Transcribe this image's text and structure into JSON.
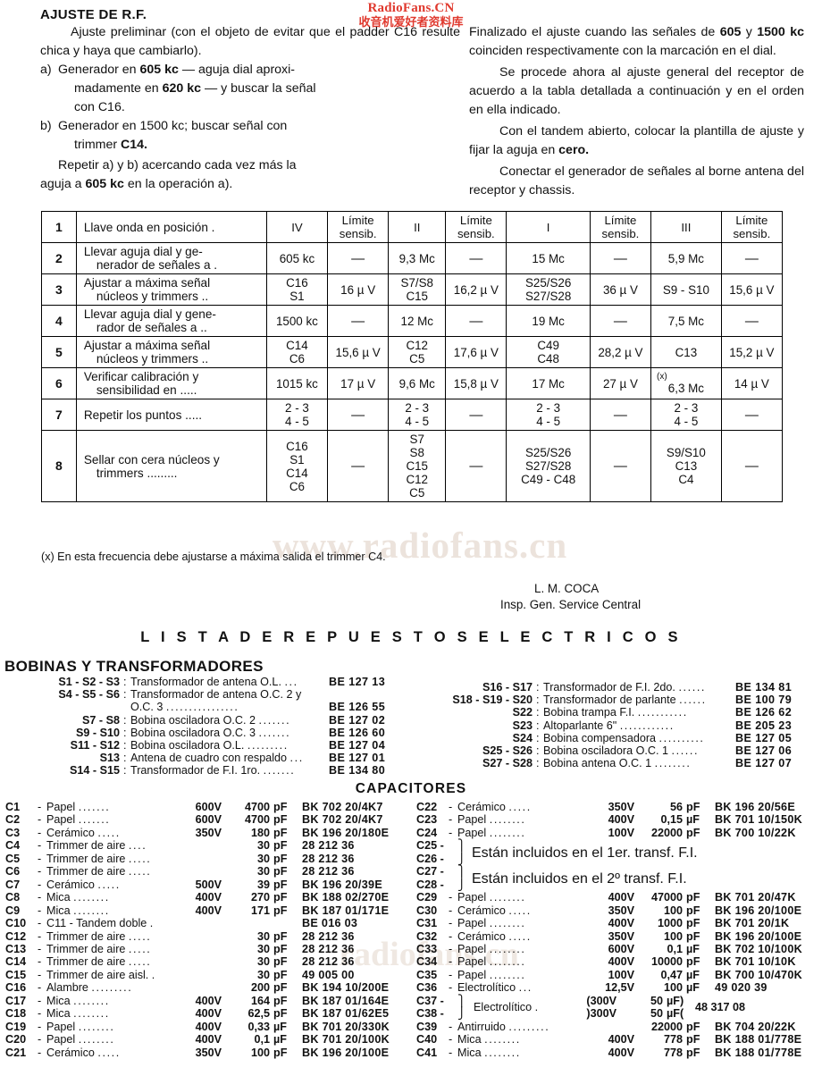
{
  "watermark": {
    "top_line1": "RadioFans.CN",
    "top_line2": "收音机爱好者资料库",
    "mid": "www.radiofans.cn",
    "mid2": "radiofans.cn"
  },
  "rf": {
    "title": "AJUSTE DE R.F.",
    "left": {
      "p1": "Ajuste preliminar (con el objeto de evitar que el padder C16 resulte chica y haya que cambiarlo).",
      "a_mark": "a)",
      "a_text": "Generador en 605 kc — aguja dial aproximadamente en 620 kc — y buscar la señal con C16.",
      "a_seg1": "Generador en ",
      "a_b1": "605 kc",
      "a_seg2": " — aguja dial aproxi-",
      "a_seg3": "madamente en ",
      "a_b2": "620 kc",
      "a_seg4": " — y buscar la señal",
      "a_seg5": "con C16.",
      "b_mark": "b)",
      "b_seg1": "Generador en 1500 kc; buscar señal con",
      "b_seg2": "trimmer ",
      "b_b1": "C14.",
      "p2_seg1": "Repetir a) y b) acercando cada vez más la",
      "p2_seg2": "aguja a ",
      "p2_b1": "605 kc",
      "p2_seg3": " en la operación a)."
    },
    "right": {
      "p1_seg1": "Finalizado el ajuste cuando las señales de",
      "p1_b1": "605",
      "p1_seg2": " y ",
      "p1_b2": "1500 kc",
      "p1_seg3": " coinciden respectivamente con la marcación en el dial.",
      "p2": "Se procede ahora al ajuste general del receptor de acuerdo a la tabla detallada a continuación y en el orden en ella indicado.",
      "p3_seg1": "Con el tandem abierto, colocar la plantilla de ajuste y fijar la aguja en ",
      "p3_b1": "cero.",
      "p4": "Conectar el generador de señales al borne antena del receptor y chassis."
    }
  },
  "table": {
    "header": {
      "num": "1",
      "desc": "Llave onda en posición .",
      "c_iv": "IV",
      "c_lim1": "Límite sensib.",
      "c_ii": "II",
      "c_lim2": "Límite sensib.",
      "c_i": "I",
      "c_lim3": "Límite sensib.",
      "c_iii": "III",
      "c_lim4": "Límite sensib."
    },
    "lim_l1": "Límite",
    "lim_l2": "sensib.",
    "rows": [
      {
        "num": "2",
        "desc_l1": "Llevar aguja dial y ge-",
        "desc_l2": "nerador de señales a .",
        "iv": "605 kc",
        "lim1": "—",
        "ii": "9,3 Mc",
        "lim2": "—",
        "i": "15 Mc",
        "lim3": "—",
        "iii": "5,9 Mc",
        "lim4": "—"
      },
      {
        "num": "3",
        "desc_l1": "Ajustar a máxima señal",
        "desc_l2": "núcleos y trimmers ..",
        "iv": "C16\nS1",
        "lim1": "16 µ V",
        "ii": "S7/S8\nC15",
        "lim2": "16,2 µ V",
        "i": "S25/S26\nS27/S28",
        "lim3": "36 µ V",
        "iii": "S9 - S10",
        "lim4": "15,6 µ V"
      },
      {
        "num": "4",
        "desc_l1": "Llevar aguja dial y gene-",
        "desc_l2": "rador de señales a ..",
        "iv": "1500 kc",
        "lim1": "—",
        "ii": "12 Mc",
        "lim2": "—",
        "i": "19 Mc",
        "lim3": "—",
        "iii": "7,5 Mc",
        "lim4": "—"
      },
      {
        "num": "5",
        "desc_l1": "Ajustar a máxima señal",
        "desc_l2": "núcleos y trimmers ..",
        "iv": "C14\nC6",
        "lim1": "15,6 µ V",
        "ii": "C12\nC5",
        "lim2": "17,6 µ V",
        "i": "C49\nC48",
        "lim3": "28,2 µ V",
        "iii": "C13",
        "lim4": "15,2 µ V"
      },
      {
        "num": "6",
        "desc_l1": "Verificar calibración y",
        "desc_l2": "sensibilidad en .....",
        "iv": "1015 kc",
        "lim1": "17 µ V",
        "ii": "9,6 Mc",
        "lim2": "15,8 µ V",
        "i": "17 Mc",
        "lim3": "27 µ V",
        "iii": "6,3 Mc",
        "iii_mark": "(x)",
        "lim4": "14 µ V"
      },
      {
        "num": "7",
        "desc_l1": "Repetir los puntos .....",
        "desc_l2": "",
        "iv": "2 - 3\n4 - 5",
        "lim1": "—",
        "ii": "2 - 3\n4 - 5",
        "lim2": "—",
        "i": "2 - 3\n4 - 5",
        "lim3": "—",
        "iii": "2 - 3\n4 - 5",
        "lim4": "—"
      },
      {
        "num": "8",
        "desc_l1": "Sellar con cera núcleos y",
        "desc_l2": "trimmers .........",
        "iv": "C16\nS1\nC14\nC6",
        "lim1": "—",
        "ii": "S7\nS8\nC15\nC12\nC5",
        "lim2": "—",
        "i": "S25/S26\nS27/S28\nC49 - C48",
        "lim3": "—",
        "iii": "S9/S10\nC13\nC4",
        "lim4": "—"
      }
    ]
  },
  "footnote": "(x)  En esta frecuencia debe ajustarse a máxima salida el trimmer C4.",
  "signature": {
    "name": "L. M. COCA",
    "role": "Insp. Gen. Service Central"
  },
  "sections": {
    "lista": "L I S T A   D E   R E P U E S T O S   E L E C T R I C O S",
    "bobinas": "BOBINAS Y TRANSFORMADORES",
    "capacitores": "CAPACITORES"
  },
  "coils_left": [
    {
      "ref": "S1 - S2 - S3",
      "colon": ":",
      "name": "Transformador de antena O.L.",
      "dots": "...",
      "pn": "BE 127 13"
    },
    {
      "ref": "S4 - S5 - S6",
      "colon": ":",
      "name": "Transformador de antena O.C. 2 y",
      "dots": "",
      "pn": ""
    },
    {
      "ref": "",
      "colon": "",
      "name": "O.C. 3",
      "dots": "................",
      "pn": "BE 126 55"
    },
    {
      "ref": "S7 - S8",
      "colon": ":",
      "name": "Bobina osciladora O.C. 2",
      "dots": ".......",
      "pn": "BE 127 02"
    },
    {
      "ref": "S9 - S10",
      "colon": ":",
      "name": "Bobina osciladora O.C. 3",
      "dots": ".......",
      "pn": "BE 126 60"
    },
    {
      "ref": "S11 - S12",
      "colon": ":",
      "name": "Bobina osciladora O.L.",
      "dots": ".........",
      "pn": "BE 127 04"
    },
    {
      "ref": "S13",
      "colon": ":",
      "name": "Antena de cuadro con respaldo",
      "dots": "...",
      "pn": "BE 127 01"
    },
    {
      "ref": "S14 - S15",
      "colon": ":",
      "name": "Transformador de F.I. 1ro.",
      "dots": ".......",
      "pn": "BE 134 80"
    }
  ],
  "coils_right": [
    {
      "ref": "S16 - S17",
      "colon": ":",
      "name": "Transformador de F.I. 2do.",
      "dots": "......",
      "pn": "BE 134 81"
    },
    {
      "ref": "S18 - S19 - S20",
      "colon": ":",
      "name": "Transformador de parlante",
      "dots": "......",
      "pn": "BE 100 79"
    },
    {
      "ref": "S22",
      "colon": ":",
      "name": "Bobina trampa F.I.",
      "dots": "...........",
      "pn": "BE 126 62"
    },
    {
      "ref": "S23",
      "colon": ":",
      "name": "Altoparlante 6\"",
      "dots": "............",
      "pn": "BE 205 23"
    },
    {
      "ref": "S24",
      "colon": ":",
      "name": "Bobina compensadora",
      "dots": "..........",
      "pn": "BE 127 05"
    },
    {
      "ref": "S25 - S26",
      "colon": ":",
      "name": "Bobina osciladora O.C. 1",
      "dots": "......",
      "pn": "BE 127 06"
    },
    {
      "ref": "S27 - S28",
      "colon": ":",
      "name": "Bobina antena O.C. 1",
      "dots": "........",
      "pn": "BE 127 07"
    }
  ],
  "caps_left": [
    {
      "ref": "C1",
      "d": "-",
      "typ": "Papel",
      "dots": ".......",
      "volt": "600V",
      "val": "4700",
      "unit": "pF",
      "pn": "BK 702 20/4K7"
    },
    {
      "ref": "C2",
      "d": "-",
      "typ": "Papel",
      "dots": ".......",
      "volt": "600V",
      "val": "4700",
      "unit": "pF",
      "pn": "BK 702 20/4K7"
    },
    {
      "ref": "C3",
      "d": "-",
      "typ": "Cerámico",
      "dots": ".....",
      "volt": "350V",
      "val": "180",
      "unit": "pF",
      "pn": "BK 196 20/180E"
    },
    {
      "ref": "C4",
      "d": "-",
      "typ": "Trimmer de aire",
      "dots": "....",
      "volt": "",
      "val": "30",
      "unit": "pF",
      "pn": "28 212 36"
    },
    {
      "ref": "C5",
      "d": "-",
      "typ": "Trimmer de aire",
      "dots": ".....",
      "volt": "",
      "val": "30",
      "unit": "pF",
      "pn": "28 212 36"
    },
    {
      "ref": "C6",
      "d": "-",
      "typ": "Trimmer de aire",
      "dots": ".....",
      "volt": "",
      "val": "30",
      "unit": "pF",
      "pn": "28 212 36"
    },
    {
      "ref": "C7",
      "d": "-",
      "typ": "Cerámico",
      "dots": ".....",
      "volt": "500V",
      "val": "39",
      "unit": "pF",
      "pn": "BK 196 20/39E"
    },
    {
      "ref": "C8",
      "d": "-",
      "typ": "Mica",
      "dots": "........",
      "volt": "400V",
      "val": "270",
      "unit": "pF",
      "pn": "BK 188 02/270E"
    },
    {
      "ref": "C9",
      "d": "-",
      "typ": "Mica",
      "dots": "........",
      "volt": "400V",
      "val": "171",
      "unit": "pF",
      "pn": "BK 187 01/171E"
    },
    {
      "ref": "C10",
      "d": "-",
      "typ": "C11 - Tandem doble .",
      "dots": "",
      "volt": "",
      "val": "",
      "unit": "",
      "pn": "BE 016 03"
    },
    {
      "ref": "C12",
      "d": "-",
      "typ": "Trimmer de aire",
      "dots": ".....",
      "volt": "",
      "val": "30",
      "unit": "pF",
      "pn": "28 212 36"
    },
    {
      "ref": "C13",
      "d": "-",
      "typ": "Trimmer de aire",
      "dots": ".....",
      "volt": "",
      "val": "30",
      "unit": "pF",
      "pn": "28 212 36"
    },
    {
      "ref": "C14",
      "d": "-",
      "typ": "Trimmer de aire",
      "dots": ".....",
      "volt": "",
      "val": "30",
      "unit": "pF",
      "pn": "28 212 36"
    },
    {
      "ref": "C15",
      "d": "-",
      "typ": "Trimmer de aire aisl.",
      "dots": ".",
      "volt": "",
      "val": "30",
      "unit": "pF",
      "pn": "49 005 00"
    },
    {
      "ref": "C16",
      "d": "-",
      "typ": "Alambre",
      "dots": ".........",
      "volt": "",
      "val": "200",
      "unit": "pF",
      "pn": "BK 194 10/200E"
    },
    {
      "ref": "C17",
      "d": "-",
      "typ": "Mica",
      "dots": "........",
      "volt": "400V",
      "val": "164",
      "unit": "pF",
      "pn": "BK 187 01/164E"
    },
    {
      "ref": "C18",
      "d": "-",
      "typ": "Mica",
      "dots": "........",
      "volt": "400V",
      "val": "62,5",
      "unit": "pF",
      "pn": "BK 187 01/62E5"
    },
    {
      "ref": "C19",
      "d": "-",
      "typ": "Papel",
      "dots": "........",
      "volt": "400V",
      "val": "0,33",
      "unit": "µF",
      "pn": "BK 701 20/330K"
    },
    {
      "ref": "C20",
      "d": "-",
      "typ": "Papel",
      "dots": "........",
      "volt": "400V",
      "val": "0,1",
      "unit": "µF",
      "pn": "BK 701 20/100K"
    },
    {
      "ref": "C21",
      "d": "-",
      "typ": "Cerámico",
      "dots": ".....",
      "volt": "350V",
      "val": "100",
      "unit": "pF",
      "pn": "BK 196 20/100E"
    }
  ],
  "caps_right_top": [
    {
      "ref": "C22",
      "d": "-",
      "typ": "Cerámico",
      "dots": ".....",
      "volt": "350V",
      "val": "56",
      "unit": "pF",
      "pn": "BK 196 20/56E"
    },
    {
      "ref": "C23",
      "d": "-",
      "typ": "Papel",
      "dots": "........",
      "volt": "400V",
      "val": "0,15",
      "unit": "µF",
      "pn": "BK 701 10/150K"
    },
    {
      "ref": "C24",
      "d": "-",
      "typ": "Papel",
      "dots": "........",
      "volt": "100V",
      "val": "22000",
      "unit": "pF",
      "pn": "BK 700 10/22K"
    }
  ],
  "caps_groups": [
    {
      "r1": "C25  -",
      "r2": "C26  -",
      "note": "Están incluidos en el 1er. transf. F.I."
    },
    {
      "r1": "C27  -",
      "r2": "C28  -",
      "note": "Están incluidos en el 2º transf. F.I."
    }
  ],
  "caps_right_mid": [
    {
      "ref": "C29",
      "d": "-",
      "typ": "Papel",
      "dots": "........",
      "volt": "400V",
      "val": "47000",
      "unit": "pF",
      "pn": "BK 701 20/47K"
    },
    {
      "ref": "C30",
      "d": "-",
      "typ": "Cerámico",
      "dots": ".....",
      "volt": "350V",
      "val": "100",
      "unit": "pF",
      "pn": "BK 196 20/100E"
    },
    {
      "ref": "C31",
      "d": "-",
      "typ": "Papel",
      "dots": "........",
      "volt": "400V",
      "val": "1000",
      "unit": "pF",
      "pn": "BK 701 20/1K"
    },
    {
      "ref": "C32",
      "d": "-",
      "typ": "Cerámico",
      "dots": ".....",
      "volt": "350V",
      "val": "100",
      "unit": "pF",
      "pn": "BK 196 20/100E"
    },
    {
      "ref": "C33",
      "d": "-",
      "typ": "Papel",
      "dots": "........",
      "volt": "600V",
      "val": "0,1",
      "unit": "µF",
      "pn": "BK 702 10/100K"
    },
    {
      "ref": "C34",
      "d": "-",
      "typ": "Papel",
      "dots": "........",
      "volt": "400V",
      "val": "10000",
      "unit": "pF",
      "pn": "BK 701 10/10K"
    },
    {
      "ref": "C35",
      "d": "-",
      "typ": "Papel",
      "dots": "........",
      "volt": "100V",
      "val": "0,47",
      "unit": "µF",
      "pn": "BK 700 10/470K"
    },
    {
      "ref": "C36",
      "d": "-",
      "typ": "Electrolítico",
      "dots": "...",
      "volt": "12,5V",
      "val": "100",
      "unit": "µF",
      "pn": "49 020 39"
    }
  ],
  "caps_electro_group": {
    "r1": "C37  -",
    "r2": "C38  -",
    "label": "Electrolítico  .",
    "v1": "(300V",
    "val1": "50",
    "u1": "µF)",
    "v2": ")300V",
    "val2": "50",
    "u2": "µF(",
    "pn": "48 317 08"
  },
  "caps_right_bottom": [
    {
      "ref": "C39",
      "d": "-",
      "typ": "Antirruido",
      "dots": ".........",
      "volt": "",
      "val": "22000",
      "unit": "pF",
      "pn": "BK 704 20/22K"
    },
    {
      "ref": "C40",
      "d": "-",
      "typ": "Mica",
      "dots": "........",
      "volt": "400V",
      "val": "778",
      "unit": "pF",
      "pn": "BK 188 01/778E"
    },
    {
      "ref": "C41",
      "d": "-",
      "typ": "Mica",
      "dots": "........",
      "volt": "400V",
      "val": "778",
      "unit": "pF",
      "pn": "BK 188 01/778E"
    }
  ]
}
